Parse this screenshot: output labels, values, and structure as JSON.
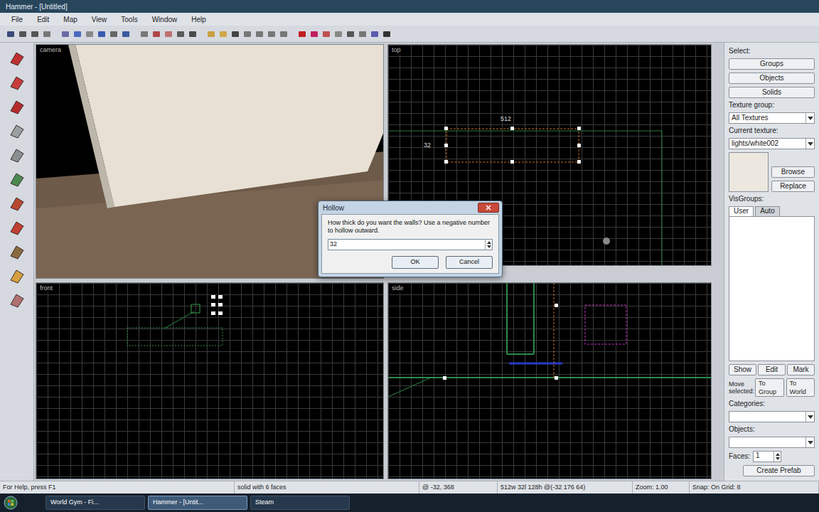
{
  "window": {
    "title": "Hammer - [Untitled]"
  },
  "menu": [
    "File",
    "Edit",
    "Map",
    "View",
    "Tools",
    "Window",
    "Help"
  ],
  "viewports": [
    {
      "label": "camera"
    },
    {
      "label": "top",
      "dims": [
        "512",
        "32"
      ]
    },
    {
      "label": "front"
    },
    {
      "label": "side"
    }
  ],
  "dialog": {
    "title": "Hollow",
    "message": "How thick do you want the walls? Use a negative number to hollow outward.",
    "value": "32",
    "buttons": [
      "OK",
      "Cancel"
    ]
  },
  "panel": {
    "select_label": "Select:",
    "select_buttons": [
      "Groups",
      "Objects",
      "Solids"
    ],
    "texture_group_label": "Texture group:",
    "texture_group": "All Textures",
    "current_texture_label": "Current texture:",
    "current_texture": "lights/white002",
    "texture_buttons": [
      "Browse",
      "Replace"
    ],
    "visgroups_label": "VisGroups:",
    "visgroup_tabs": [
      {
        "label": "User",
        "selected": true
      },
      {
        "label": "Auto",
        "selected": false
      }
    ],
    "visgroup_buttons": [
      "Show",
      "Edit",
      "Mark"
    ],
    "move_label": "Move selected:",
    "move_buttons": [
      "To Group",
      "To World"
    ],
    "categories_label": "Categories:",
    "objects_label": "Objects:",
    "faces_label": "Faces:",
    "faces_value": "1",
    "prefab_button": "Create Prefab"
  },
  "status_bar": [
    "For Help, press F1",
    "solid with 6 faces",
    "@ -32, 368",
    "512w 32l 128h @(-32 176 64)",
    "Zoom: 1.00",
    "Snap: On Grid: 8"
  ],
  "taskbar": [
    {
      "label": "World Gym - Fi...",
      "selected": false
    },
    {
      "label": "Hammer - [Untit...",
      "selected": true
    },
    {
      "label": "Steam",
      "selected": false
    }
  ]
}
